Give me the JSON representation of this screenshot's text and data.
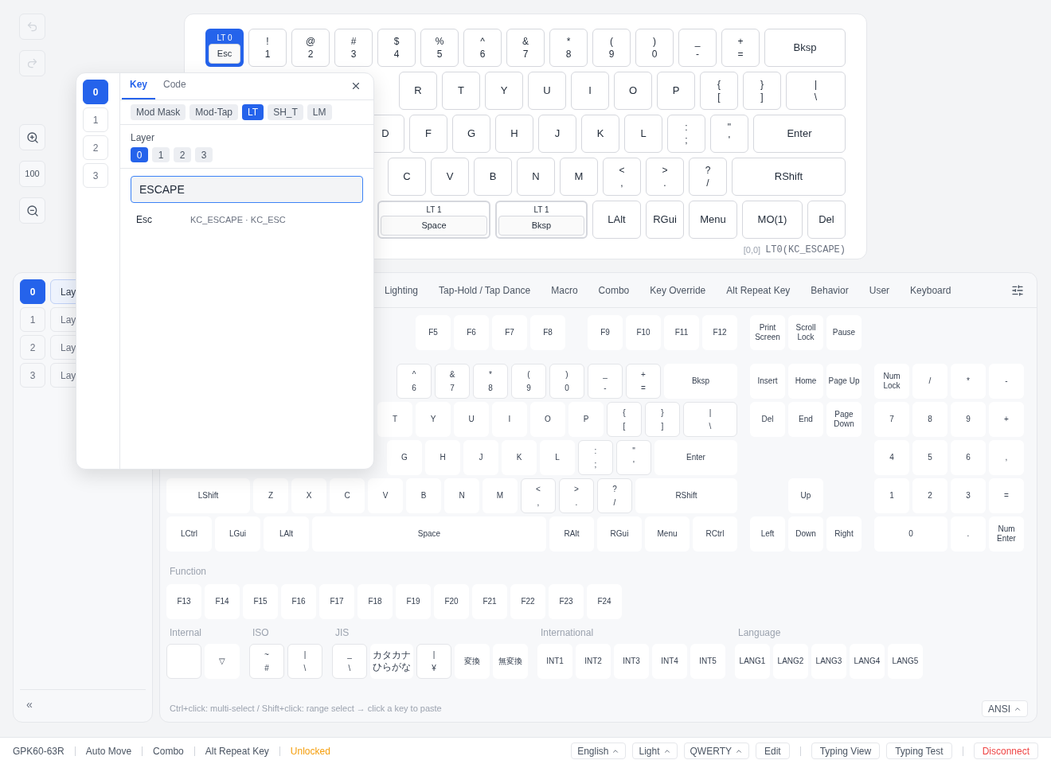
{
  "toolbar": {
    "undo": {
      "disabled": true
    },
    "redo": {
      "disabled": true
    },
    "zoom": "100"
  },
  "keymap": {
    "rows": [
      {
        "keys": [
          {
            "kind": "layer_tap",
            "top": "LT 0",
            "label": "Esc",
            "selected": true
          },
          {
            "kind": "shifted",
            "top": "!",
            "label": "1",
            "selected": false
          },
          {
            "kind": "shifted",
            "top": "@",
            "label": "2",
            "selected": false
          },
          {
            "kind": "shifted",
            "top": "#",
            "label": "3",
            "selected": false
          },
          {
            "kind": "shifted",
            "top": "$",
            "label": "4",
            "selected": false
          },
          {
            "kind": "shifted",
            "top": "%",
            "label": "5",
            "selected": false
          },
          {
            "kind": "shifted",
            "top": "^",
            "label": "6",
            "selected": false
          },
          {
            "kind": "shifted",
            "top": "&",
            "label": "7",
            "selected": false
          },
          {
            "kind": "shifted",
            "top": "*",
            "label": "8",
            "selected": false
          },
          {
            "kind": "shifted",
            "top": "(",
            "label": "9",
            "selected": false
          },
          {
            "kind": "shifted",
            "top": ")",
            "label": "0",
            "selected": false
          },
          {
            "kind": "shifted",
            "top": "_",
            "label": "-",
            "selected": false
          },
          {
            "kind": "shifted",
            "top": "+",
            "label": "=",
            "selected": false
          },
          {
            "kind": "plain",
            "label": "Bksp",
            "selected": false
          }
        ]
      },
      {
        "keys": [
          {
            "kind": "plain",
            "label": "R",
            "selected": false
          },
          {
            "kind": "plain",
            "label": "T",
            "selected": false
          },
          {
            "kind": "plain",
            "label": "Y",
            "selected": false
          },
          {
            "kind": "plain",
            "label": "U",
            "selected": false
          },
          {
            "kind": "plain",
            "label": "I",
            "selected": false
          },
          {
            "kind": "plain",
            "label": "O",
            "selected": false
          },
          {
            "kind": "plain",
            "label": "P",
            "selected": false
          },
          {
            "kind": "shifted",
            "top": "{",
            "label": "[",
            "selected": false
          },
          {
            "kind": "shifted",
            "top": "}",
            "label": "]",
            "selected": false
          },
          {
            "kind": "shifted",
            "top": "|",
            "label": "\\",
            "selected": false
          }
        ]
      },
      {
        "keys": [
          {
            "kind": "plain",
            "label": "D",
            "selected": false
          },
          {
            "kind": "plain",
            "label": "F",
            "selected": false
          },
          {
            "kind": "plain",
            "label": "G",
            "selected": false
          },
          {
            "kind": "plain",
            "label": "H",
            "selected": false
          },
          {
            "kind": "plain",
            "label": "J",
            "selected": false
          },
          {
            "kind": "plain",
            "label": "K",
            "selected": false
          },
          {
            "kind": "plain",
            "label": "L",
            "selected": false
          },
          {
            "kind": "shifted",
            "top": ":",
            "label": ";",
            "selected": false
          },
          {
            "kind": "shifted",
            "top": "\"",
            "label": "'",
            "selected": false
          },
          {
            "kind": "plain",
            "label": "Enter",
            "selected": false
          }
        ]
      },
      {
        "keys": [
          {
            "kind": "plain",
            "label": "C",
            "selected": false
          },
          {
            "kind": "plain",
            "label": "V",
            "selected": false
          },
          {
            "kind": "plain",
            "label": "B",
            "selected": false
          },
          {
            "kind": "plain",
            "label": "N",
            "selected": false
          },
          {
            "kind": "plain",
            "label": "M",
            "selected": false
          },
          {
            "kind": "shifted",
            "top": "<",
            "label": ",",
            "selected": false
          },
          {
            "kind": "shifted",
            "top": ">",
            "label": ".",
            "selected": false
          },
          {
            "kind": "shifted",
            "top": "?",
            "label": "/",
            "selected": false
          },
          {
            "kind": "plain",
            "label": "RShift",
            "selected": false
          }
        ]
      },
      {
        "keys": [
          {
            "kind": "layer_tap",
            "top": "LT 1",
            "label": "Space",
            "selected": false
          },
          {
            "kind": "layer_tap",
            "top": "LT 1",
            "label": "Bksp",
            "selected": false
          },
          {
            "kind": "plain",
            "label": "LAlt",
            "selected": false
          },
          {
            "kind": "plain",
            "label": "RGui",
            "selected": false
          },
          {
            "kind": "plain",
            "label": "Menu",
            "selected": false
          },
          {
            "kind": "plain",
            "label": "MO(1)",
            "selected": false
          },
          {
            "kind": "plain",
            "label": "Del",
            "selected": false
          }
        ]
      }
    ],
    "position": "[0,0]",
    "code": "LT0(KC_ESCAPE)"
  },
  "layers_panel": {
    "items": [
      {
        "number": "0",
        "label": "Lay",
        "selected": true
      },
      {
        "number": "1",
        "label": "Lay",
        "selected": false
      },
      {
        "number": "2",
        "label": "Lay",
        "selected": false
      },
      {
        "number": "3",
        "label": "Lay",
        "selected": false
      }
    ],
    "collapse": "«"
  },
  "palette": {
    "tabs": [
      {
        "label": "Lighting",
        "selected": false
      },
      {
        "label": "Tap-Hold / Tap Dance",
        "selected": false
      },
      {
        "label": "Macro",
        "selected": false
      },
      {
        "label": "Combo",
        "selected": false
      },
      {
        "label": "Key Override",
        "selected": false
      },
      {
        "label": "Alt Repeat Key",
        "selected": false
      },
      {
        "label": "Behavior",
        "selected": false
      },
      {
        "label": "User",
        "selected": false
      },
      {
        "label": "Keyboard",
        "selected": false
      }
    ],
    "f_groups": [
      {
        "keys": [
          {
            "kind": "plain",
            "label": "F5"
          },
          {
            "kind": "plain",
            "label": "F6"
          },
          {
            "kind": "plain",
            "label": "F7"
          },
          {
            "kind": "plain",
            "label": "F8"
          }
        ]
      },
      {
        "keys": [
          {
            "kind": "plain",
            "label": "F9"
          },
          {
            "kind": "plain",
            "label": "F10"
          },
          {
            "kind": "plain",
            "label": "F11"
          },
          {
            "kind": "plain",
            "label": "F12"
          }
        ]
      }
    ],
    "main_rows": [
      {
        "keys": [
          {
            "kind": "shifted",
            "top": "^",
            "label": "6"
          },
          {
            "kind": "shifted",
            "top": "&",
            "label": "7"
          },
          {
            "kind": "shifted",
            "top": "*",
            "label": "8"
          },
          {
            "kind": "shifted",
            "top": "(",
            "label": "9"
          },
          {
            "kind": "shifted",
            "top": ")",
            "label": "0"
          },
          {
            "kind": "shifted",
            "top": "_",
            "label": "-"
          },
          {
            "kind": "shifted",
            "top": "+",
            "label": "="
          },
          {
            "kind": "plain",
            "label": "Bksp"
          }
        ]
      },
      {
        "keys": [
          {
            "kind": "plain",
            "label": "T"
          },
          {
            "kind": "plain",
            "label": "Y"
          },
          {
            "kind": "plain",
            "label": "U"
          },
          {
            "kind": "plain",
            "label": "I"
          },
          {
            "kind": "plain",
            "label": "O"
          },
          {
            "kind": "plain",
            "label": "P"
          },
          {
            "kind": "shifted",
            "top": "{",
            "label": "["
          },
          {
            "kind": "shifted",
            "top": "}",
            "label": "]"
          },
          {
            "kind": "shifted",
            "top": "|",
            "label": "\\"
          }
        ]
      },
      {
        "keys": [
          {
            "kind": "plain",
            "label": "G"
          },
          {
            "kind": "plain",
            "label": "H"
          },
          {
            "kind": "plain",
            "label": "J"
          },
          {
            "kind": "plain",
            "label": "K"
          },
          {
            "kind": "plain",
            "label": "L"
          },
          {
            "kind": "shifted",
            "top": ":",
            "label": ";"
          },
          {
            "kind": "shifted",
            "top": "\"",
            "label": "'"
          },
          {
            "kind": "plain",
            "label": "Enter"
          }
        ]
      },
      {
        "keys": [
          {
            "kind": "plain",
            "label": "LShift"
          },
          {
            "kind": "plain",
            "label": "Z"
          },
          {
            "kind": "plain",
            "label": "X"
          },
          {
            "kind": "plain",
            "label": "C"
          },
          {
            "kind": "plain",
            "label": "V"
          },
          {
            "kind": "plain",
            "label": "B"
          },
          {
            "kind": "plain",
            "label": "N"
          },
          {
            "kind": "plain",
            "label": "M"
          },
          {
            "kind": "shifted",
            "top": "<",
            "label": ","
          },
          {
            "kind": "shifted",
            "top": ">",
            "label": "."
          },
          {
            "kind": "shifted",
            "top": "?",
            "label": "/"
          },
          {
            "kind": "plain",
            "label": "RShift"
          }
        ]
      },
      {
        "keys": [
          {
            "kind": "plain",
            "label": "LCtrl"
          },
          {
            "kind": "plain",
            "label": "LGui"
          },
          {
            "kind": "plain",
            "label": "LAlt"
          },
          {
            "kind": "plain",
            "label": "Space"
          },
          {
            "kind": "plain",
            "label": "RAlt"
          },
          {
            "kind": "plain",
            "label": "RGui"
          },
          {
            "kind": "plain",
            "label": "Menu"
          },
          {
            "kind": "plain",
            "label": "RCtrl"
          }
        ]
      }
    ],
    "nav_rows": [
      {
        "keys": [
          {
            "kind": "plain",
            "label": "Print Screen"
          },
          {
            "kind": "plain",
            "label": "Scroll Lock"
          },
          {
            "kind": "plain",
            "label": "Pause"
          }
        ]
      },
      {
        "keys": [
          {
            "kind": "plain",
            "label": "Insert"
          },
          {
            "kind": "plain",
            "label": "Home"
          },
          {
            "kind": "plain",
            "label": "Page Up"
          }
        ]
      },
      {
        "keys": [
          {
            "kind": "plain",
            "label": "Del"
          },
          {
            "kind": "plain",
            "label": "End"
          },
          {
            "kind": "plain",
            "label": "Page Down"
          }
        ]
      },
      {
        "keys": [
          {
            "kind": "gap"
          }
        ]
      },
      {
        "keys": [
          {
            "kind": "gap"
          },
          {
            "kind": "plain",
            "label": "Up"
          }
        ]
      },
      {
        "keys": [
          {
            "kind": "plain",
            "label": "Left"
          },
          {
            "kind": "plain",
            "label": "Down"
          },
          {
            "kind": "plain",
            "label": "Right"
          }
        ]
      }
    ],
    "numpad_rows": [
      {
        "keys": [
          {
            "kind": "plain",
            "label": "Num Lock"
          },
          {
            "kind": "plain",
            "label": "/"
          },
          {
            "kind": "plain",
            "label": "*"
          },
          {
            "kind": "plain",
            "label": "-"
          }
        ]
      },
      {
        "keys": [
          {
            "kind": "plain",
            "label": "7"
          },
          {
            "kind": "plain",
            "label": "8"
          },
          {
            "kind": "plain",
            "label": "9"
          },
          {
            "kind": "plain",
            "label": "+"
          }
        ]
      },
      {
        "keys": [
          {
            "kind": "plain",
            "label": "4"
          },
          {
            "kind": "plain",
            "label": "5"
          },
          {
            "kind": "plain",
            "label": "6"
          },
          {
            "kind": "plain",
            "label": ","
          }
        ]
      },
      {
        "keys": [
          {
            "kind": "plain",
            "label": "1"
          },
          {
            "kind": "plain",
            "label": "2"
          },
          {
            "kind": "plain",
            "label": "3"
          },
          {
            "kind": "plain",
            "label": "="
          }
        ]
      },
      {
        "keys": [
          {
            "kind": "plain",
            "label": "0"
          },
          {
            "kind": "plain",
            "label": "."
          },
          {
            "kind": "plain",
            "label": "Num Enter"
          }
        ]
      }
    ],
    "function": {
      "title": "Function",
      "keys": [
        {
          "kind": "plain",
          "label": "F13"
        },
        {
          "kind": "plain",
          "label": "F14"
        },
        {
          "kind": "plain",
          "label": "F15"
        },
        {
          "kind": "plain",
          "label": "F16"
        },
        {
          "kind": "plain",
          "label": "F17"
        },
        {
          "kind": "plain",
          "label": "F18"
        },
        {
          "kind": "plain",
          "label": "F19"
        },
        {
          "kind": "plain",
          "label": "F20"
        },
        {
          "kind": "plain",
          "label": "F21"
        },
        {
          "kind": "plain",
          "label": "F22"
        },
        {
          "kind": "plain",
          "label": "F23"
        },
        {
          "kind": "plain",
          "label": "F24"
        }
      ]
    },
    "groups": [
      {
        "title": "Internal",
        "keys": [
          {
            "kind": "blank"
          },
          {
            "kind": "plain",
            "label": "▽"
          }
        ]
      },
      {
        "title": "ISO",
        "keys": [
          {
            "kind": "shifted",
            "top": "~",
            "label": "#"
          },
          {
            "kind": "shifted",
            "top": "|",
            "label": "\\"
          }
        ]
      },
      {
        "title": "JIS",
        "keys": [
          {
            "kind": "shifted",
            "top": "_",
            "label": "\\"
          },
          {
            "kind": "two_line",
            "lines": [
              "カタカナ",
              "ひらがな"
            ]
          },
          {
            "kind": "shifted",
            "top": "|",
            "label": "¥"
          },
          {
            "kind": "plain",
            "label": "変換"
          },
          {
            "kind": "plain",
            "label": "無変換"
          }
        ]
      },
      {
        "title": "International",
        "keys": [
          {
            "kind": "plain",
            "label": "INT1"
          },
          {
            "kind": "plain",
            "label": "INT2"
          },
          {
            "kind": "plain",
            "label": "INT3"
          },
          {
            "kind": "plain",
            "label": "INT4"
          },
          {
            "kind": "plain",
            "label": "INT5"
          }
        ]
      },
      {
        "title": "Language",
        "keys": [
          {
            "kind": "plain",
            "label": "LANG1"
          },
          {
            "kind": "plain",
            "label": "LANG2"
          },
          {
            "kind": "plain",
            "label": "LANG3"
          },
          {
            "kind": "plain",
            "label": "LANG4"
          },
          {
            "kind": "plain",
            "label": "LANG5"
          }
        ]
      }
    ],
    "hint": "Ctrl+click: multi-select / Shift+click: range select → click a key to paste",
    "layout_select": "ANSI"
  },
  "popup": {
    "layers": [
      {
        "label": "0",
        "selected": true
      },
      {
        "label": "1",
        "selected": false
      },
      {
        "label": "2",
        "selected": false
      },
      {
        "label": "3",
        "selected": false
      }
    ],
    "tabs": [
      {
        "label": "Key",
        "selected": true
      },
      {
        "label": "Code",
        "selected": false
      }
    ],
    "types": [
      {
        "label": "Mod Mask",
        "selected": false
      },
      {
        "label": "Mod-Tap",
        "selected": false
      },
      {
        "label": "LT",
        "selected": true
      },
      {
        "label": "SH_T",
        "selected": false
      },
      {
        "label": "LM",
        "selected": false
      }
    ],
    "layer_label": "Layer",
    "layer_options": [
      {
        "label": "0",
        "selected": true
      },
      {
        "label": "1",
        "selected": false
      },
      {
        "label": "2",
        "selected": false
      },
      {
        "label": "3",
        "selected": false
      }
    ],
    "search_value": "ESCAPE",
    "results": [
      {
        "name": "Esc",
        "codes": "KC_ESCAPE · KC_ESC"
      }
    ]
  },
  "status_bar": {
    "left": [
      {
        "label": "GPK60-63R",
        "kind": "text"
      },
      {
        "label": "Auto Move",
        "kind": "text"
      },
      {
        "label": "Combo",
        "kind": "text"
      },
      {
        "label": "Alt Repeat Key",
        "kind": "text"
      },
      {
        "label": "Unlocked",
        "kind": "warning"
      }
    ],
    "right_groups": [
      {
        "items": [
          {
            "label": "English",
            "kind": "dropdown"
          },
          {
            "label": "Light",
            "kind": "dropdown"
          },
          {
            "label": "QWERTY",
            "kind": "dropdown"
          },
          {
            "label": "Edit",
            "kind": "button"
          }
        ]
      },
      {
        "items": [
          {
            "label": "Typing View",
            "kind": "button"
          },
          {
            "label": "Typing Test",
            "kind": "button"
          }
        ]
      },
      {
        "items": [
          {
            "label": "Disconnect",
            "kind": "danger"
          }
        ]
      }
    ]
  }
}
